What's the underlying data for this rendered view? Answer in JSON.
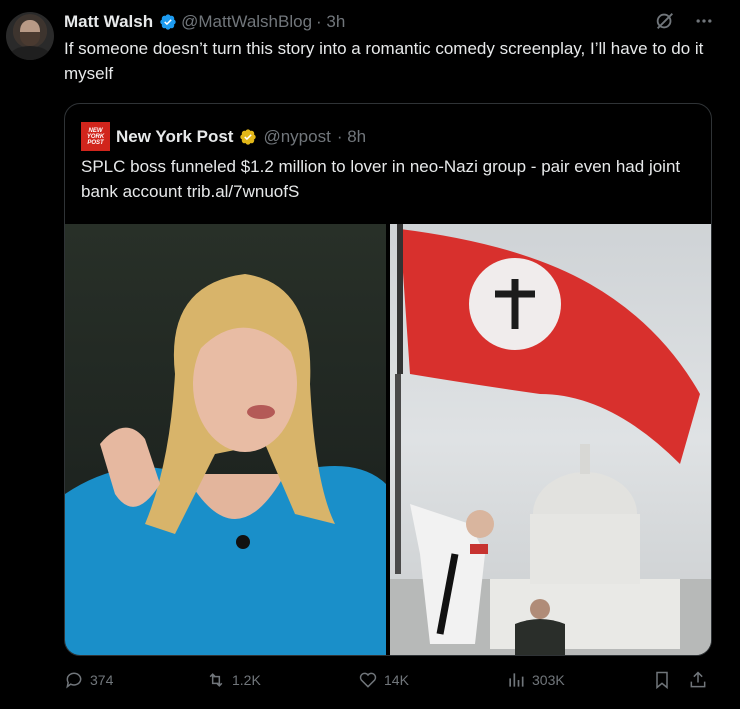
{
  "tweet": {
    "name": "Matt Walsh",
    "handle": "@MattWalshBlog",
    "time": "· 3h",
    "text": "If someone doesn’t turn this story into a romantic comedy screenplay, I’ll have to do it myself"
  },
  "quote": {
    "logo_text": "NEW YORK POST",
    "name": "New York Post",
    "handle": "@nypost",
    "time": "· 8h",
    "text": "SPLC boss funneled $1.2 million to lover in neo-Nazi group - pair even had joint bank account trib.al/7wnuofS"
  },
  "actions": {
    "replies": "374",
    "reposts": "1.2K",
    "likes": "14K",
    "views": "303K"
  },
  "colors": {
    "background": "#000000",
    "text": "#e7e9ea",
    "muted": "#71767b",
    "border": "#2f3336",
    "verified_blue": "#1d9bf0",
    "verified_gold": "#e2b719",
    "nyp_red": "#d1251c"
  },
  "icons": {
    "verified": "verified-badge-icon",
    "grok": "grok-icon",
    "more": "more-icon",
    "reply": "reply-icon",
    "repost": "repost-icon",
    "like": "heart-icon",
    "views": "views-icon",
    "bookmark": "bookmark-icon",
    "share": "share-icon"
  }
}
